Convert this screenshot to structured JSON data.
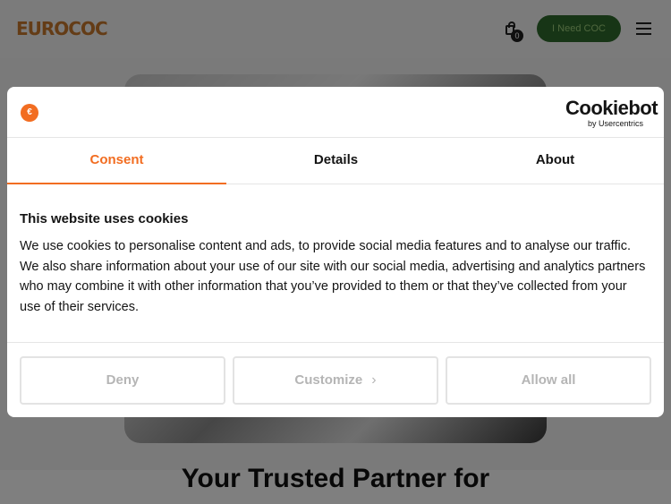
{
  "site": {
    "logo_text": "EUROCOC",
    "cart_count": "0",
    "cta_label": "I Need COC",
    "hero_heading": "Your Trusted Partner for"
  },
  "cookie_dialog": {
    "brand_mark": "€",
    "provider_name": "Cookiebot",
    "provider_sub": "by Usercentrics",
    "tabs": [
      {
        "label": "Consent",
        "active": true
      },
      {
        "label": "Details",
        "active": false
      },
      {
        "label": "About",
        "active": false
      }
    ],
    "title": "This website uses cookies",
    "text": "We use cookies to personalise content and ads, to provide social media features and to analyse our traffic. We also share information about your use of our site with our social media, advertising and analytics partners who may combine it with other information that you’ve provided to them or that they’ve collected from your use of their services.",
    "buttons": {
      "deny": "Deny",
      "customize": "Customize",
      "allow_all": "Allow all"
    }
  },
  "colors": {
    "accent": "#f26d21",
    "cta_bg": "#2f6b2c",
    "logo": "#c8782c"
  }
}
